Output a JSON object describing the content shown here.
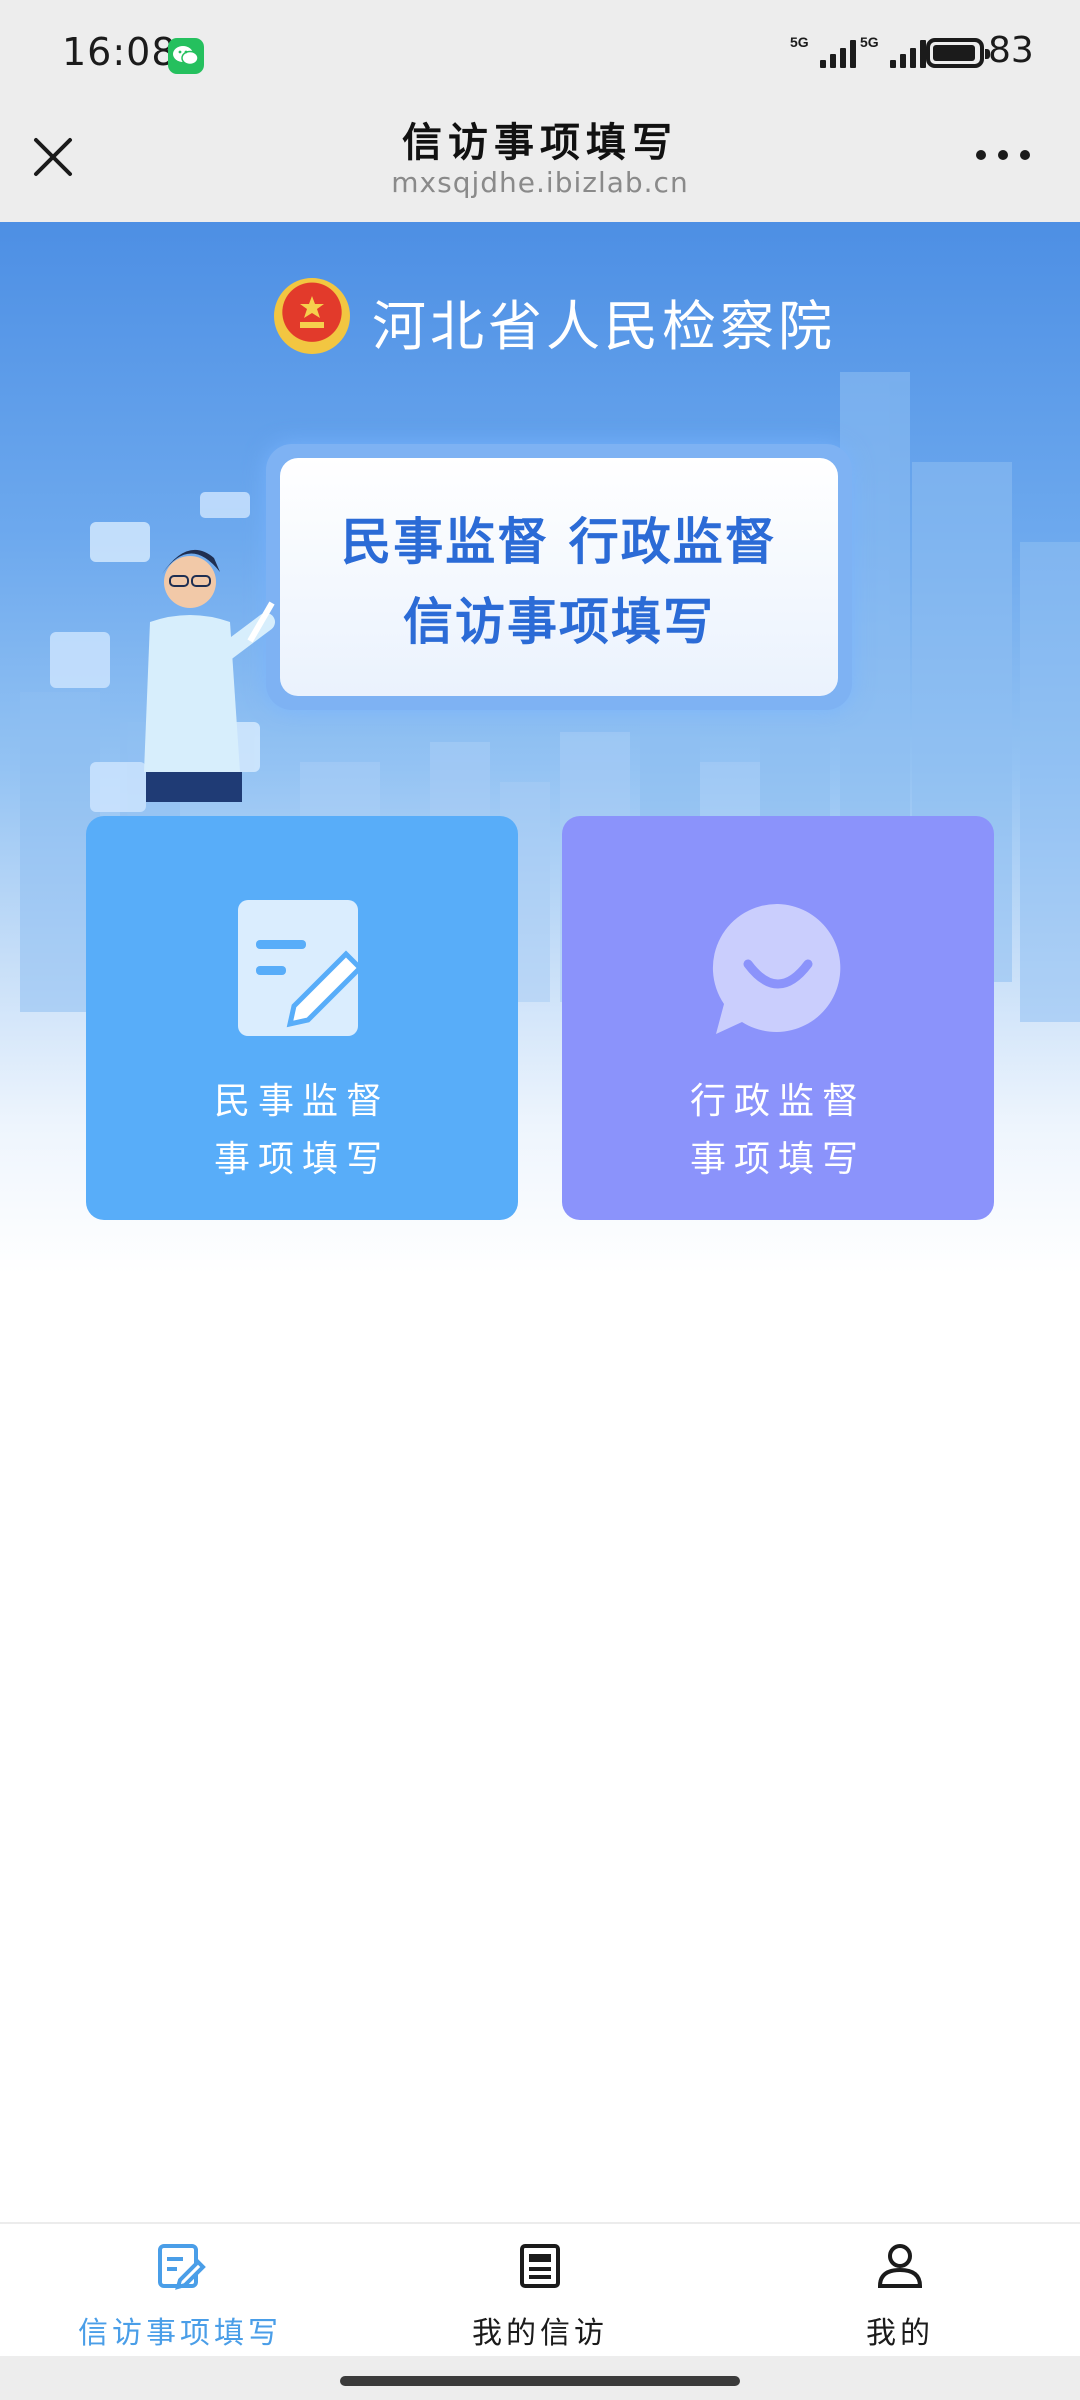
{
  "status_bar": {
    "time": "16:08",
    "signal_1_label": "5G",
    "signal_2_label": "5G",
    "battery_level": "83",
    "icons": [
      "wechat-icon",
      "signal-icon",
      "battery-icon"
    ]
  },
  "title_bar": {
    "title": "信访事项填写",
    "url": "mxsqjdhe.ibizlab.cn",
    "icons": [
      "close-icon",
      "more-icon"
    ]
  },
  "hero": {
    "org_name": "河北省人民检察院",
    "banner_line1": "民事监督 行政监督",
    "banner_line2": "信访事项填写",
    "icons": [
      "emblem-icon"
    ]
  },
  "cards": [
    {
      "line1": "民事监督",
      "line2": "事项填写",
      "icon": "edit-document-icon",
      "color": "#58adf9"
    },
    {
      "line1": "行政监督",
      "line2": "事项填写",
      "icon": "chat-smile-icon",
      "color": "#8b93fb"
    }
  ],
  "bottom_nav": {
    "active_color": "#4a9ee8",
    "inactive_color": "#1b1b1b",
    "items": [
      {
        "label": "信访事项填写",
        "icon": "edit-icon",
        "active": true
      },
      {
        "label": "我的信访",
        "icon": "document-list-icon",
        "active": false
      },
      {
        "label": "我的",
        "icon": "user-icon",
        "active": false
      }
    ]
  }
}
